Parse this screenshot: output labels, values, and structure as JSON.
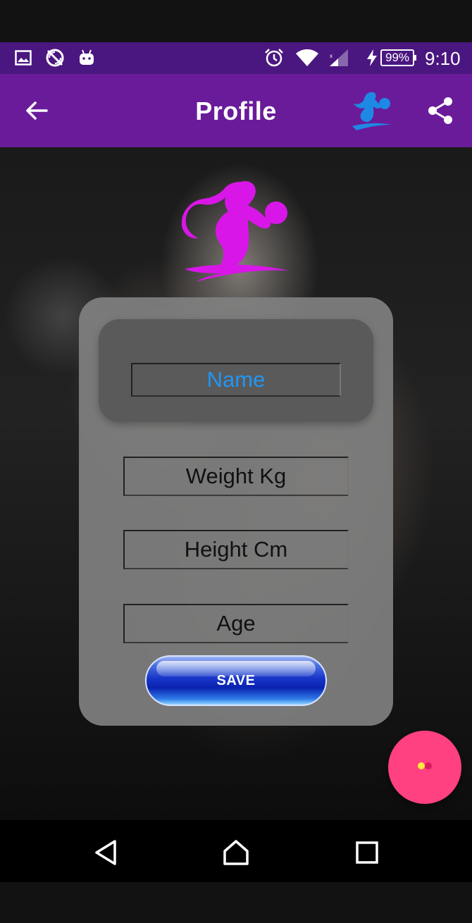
{
  "status_bar": {
    "battery": "99%",
    "time": "9:10",
    "icons": [
      "image-icon",
      "no-sync-icon",
      "android-icon",
      "alarm-icon",
      "wifi-icon",
      "signal-icon",
      "charging-icon"
    ]
  },
  "app_bar": {
    "title": "Profile",
    "back_icon": "arrow-back-icon",
    "logo_icon": "fitness-girl-logo-icon",
    "share_icon": "share-icon"
  },
  "form": {
    "name_placeholder": "Name",
    "weight_placeholder": "Weight Kg",
    "height_placeholder": "Height Cm",
    "age_placeholder": "Age",
    "save_label": "SAVE"
  },
  "colors": {
    "status_bar": "#4a1680",
    "app_bar": "#6a1b9a",
    "logo_magenta": "#d916e8",
    "name_accent": "#2196f3",
    "fab": "#ff4081",
    "save_button": "#1836c8"
  },
  "nav_bar": {
    "back": "nav-back-icon",
    "home": "nav-home-icon",
    "recents": "nav-recents-icon"
  }
}
